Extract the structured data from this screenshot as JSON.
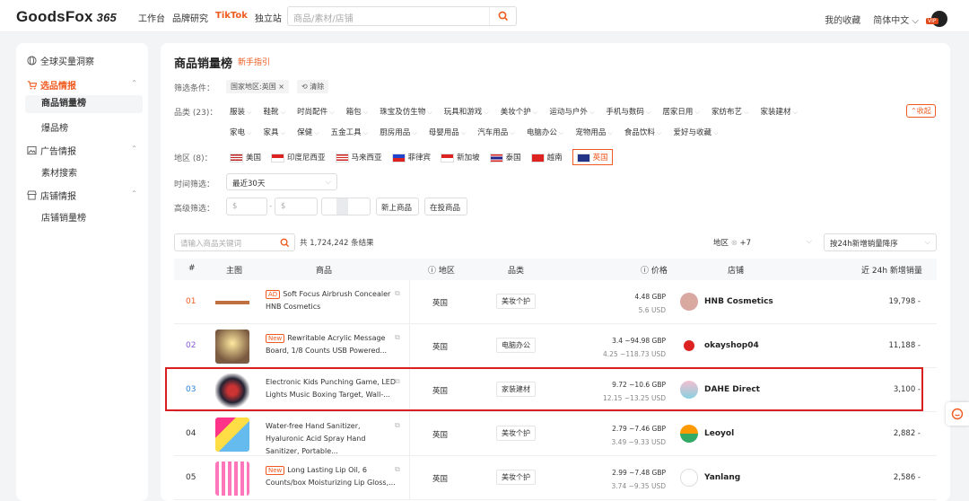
{
  "topbar": {
    "logo": "GoodsFox",
    "logo_num": "365",
    "nav": [
      "工作台",
      "品牌研究",
      "TikTok",
      "独立站"
    ],
    "search_placeholder": "商品/素材/店铺",
    "favorites": "我的收藏",
    "language": "简体中文",
    "vip": "VIP"
  },
  "sidebar": {
    "sections": [
      {
        "label": "全球买量洞察",
        "icon": "globe-icon"
      },
      {
        "label": "选品情报",
        "icon": "cart-icon",
        "children": [
          "商品销量榜",
          "爆品榜"
        ]
      },
      {
        "label": "广告情报",
        "icon": "image-icon",
        "children": [
          "素材搜索"
        ]
      },
      {
        "label": "店铺情报",
        "icon": "store-icon",
        "children": [
          "店铺销量榜"
        ]
      }
    ]
  },
  "main": {
    "title": "商品销量榜",
    "guide": "新手指引",
    "filter_label": "筛选条件：",
    "filter_tag": "国家地区:英国",
    "clear_label": "清除",
    "category_label": "品类 (23)：",
    "categories_row1": [
      "服装",
      "鞋靴",
      "时尚配件",
      "箱包",
      "珠宝及仿生物",
      "玩具和游戏",
      "美妆个护",
      "运动与户外",
      "手机与数码",
      "居家日用",
      "家纺布艺",
      "家装建材"
    ],
    "categories_row2": [
      "家电",
      "家具",
      "保健",
      "五金工具",
      "厨房用品",
      "母婴用品",
      "汽车用品",
      "电脑办公",
      "宠物用品",
      "食品饮料",
      "爱好与收藏"
    ],
    "collapse_label": "收起",
    "region_label": "地区 (8)：",
    "regions": [
      "美国",
      "印度尼西亚",
      "马来西亚",
      "菲律宾",
      "新加坡",
      "泰国",
      "越南",
      "英国"
    ],
    "time_label": "时间筛选：",
    "time_value": "最近30天",
    "advanced_label": "高级筛选：",
    "price_from": "$",
    "price_to": "$",
    "new_listing": "新上商品",
    "on_ad": "在投商品",
    "keyword_placeholder": "请输入商品关键词",
    "result_count": "共 1,724,242 条结果",
    "region_filter": "地区",
    "region_filter_extra": "+7",
    "sort_value": "按24h新增销量降序"
  },
  "table": {
    "headers": [
      "#",
      "主图",
      "商品",
      "地区",
      "品类",
      "价格",
      "店铺",
      "近 24h 新增销量"
    ],
    "rows": [
      {
        "rank": "01",
        "tag": "AD",
        "name": "Soft Focus Airbrush Concealer HNB Cosmetics",
        "region": "英国",
        "category": "美妆个护",
        "price_gbp": "4.48 GBP",
        "price_usd": "5.6 USD",
        "shop": "HNB Cosmetics",
        "sales": "19,798 -"
      },
      {
        "rank": "02",
        "tag": "New",
        "name": "Rewritable Acrylic Message Board, 1/8 Counts USB Powered...",
        "region": "英国",
        "category": "电脑办公",
        "price_gbp": "3.4 ~94.98 GBP",
        "price_usd": "4.25 ~118.73 USD",
        "shop": "okayshop04",
        "sales": "11,188 -"
      },
      {
        "rank": "03",
        "tag": "",
        "name": "Electronic Kids Punching Game, LED Lights Music Boxing Target, Wall-...",
        "region": "英国",
        "category": "家装建材",
        "price_gbp": "9.72 ~10.6 GBP",
        "price_usd": "12.15 ~13.25 USD",
        "shop": "DAHE Direct",
        "sales": "3,100 -"
      },
      {
        "rank": "04",
        "tag": "",
        "name": "Water-free Hand Sanitizer, Hyaluronic Acid Spray Hand Sanitizer, Portable...",
        "region": "英国",
        "category": "美妆个护",
        "price_gbp": "2.79 ~7.46 GBP",
        "price_usd": "3.49 ~9.33 USD",
        "shop": "Leoyol",
        "sales": "2,882 -"
      },
      {
        "rank": "05",
        "tag": "New",
        "name": "Long Lasting Lip Oil, 6 Counts/box Moisturizing Lip Gloss,...",
        "region": "英国",
        "category": "美妆个护",
        "price_gbp": "2.99 ~7.48 GBP",
        "price_usd": "3.74 ~9.35 USD",
        "shop": "Yanlang",
        "sales": "2,586 -"
      }
    ]
  }
}
